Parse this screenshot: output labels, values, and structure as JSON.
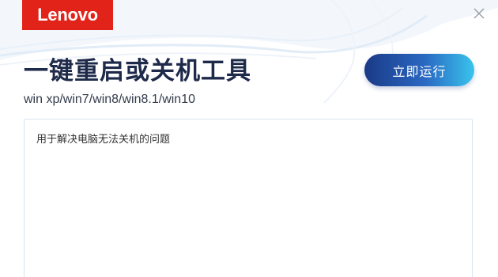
{
  "brand": {
    "name": "Lenovo",
    "color": "#e2231a"
  },
  "window": {
    "close_icon": "close-icon"
  },
  "header": {
    "title": "一键重启或关机工具",
    "subtitle": "win xp/win7/win8/win8.1/win10"
  },
  "actions": {
    "run_label": "立即运行"
  },
  "description": {
    "text": "用于解决电脑无法关机的问题"
  },
  "colors": {
    "title": "#1e2a4a",
    "button_start": "#1a3a86",
    "button_end": "#39c4ec",
    "box_border": "#d7e3ef"
  }
}
